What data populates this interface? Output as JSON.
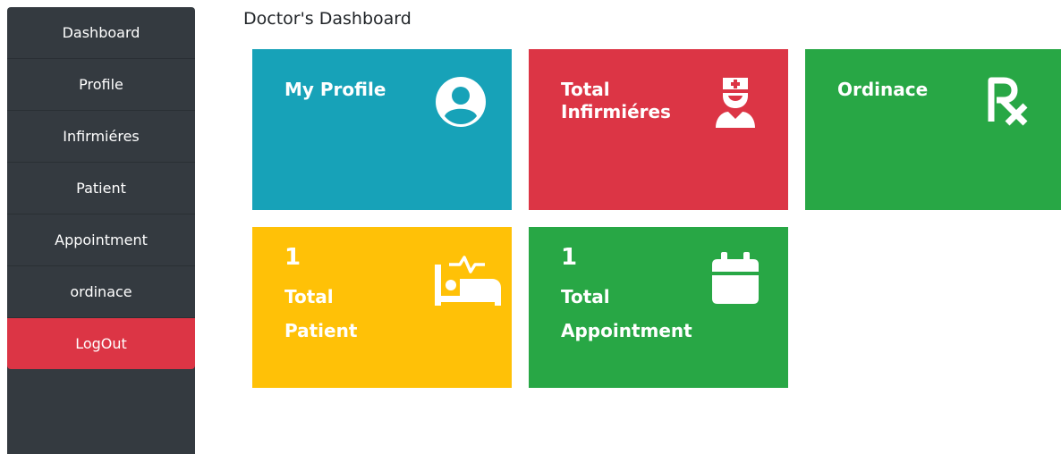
{
  "sidebar": {
    "items": [
      {
        "label": "Dashboard"
      },
      {
        "label": "Profile"
      },
      {
        "label": "Infirmiéres"
      },
      {
        "label": "Patient"
      },
      {
        "label": "Appointment"
      },
      {
        "label": "ordinace"
      },
      {
        "label": "LogOut",
        "active": true
      }
    ]
  },
  "page_title": "Doctor's Dashboard",
  "tiles": {
    "profile": {
      "title": "My Profile",
      "color": "#17a2b8",
      "icon": "user-circle-icon"
    },
    "nurses": {
      "title_line1": "Total",
      "title_line2": "Infirmiéres",
      "color": "#dc3545",
      "icon": "nurse-icon"
    },
    "ordinace": {
      "title": "Ordinace",
      "color": "#28a745",
      "icon": "prescription-icon"
    },
    "patients": {
      "count": "1",
      "label_line1": "Total",
      "label_line2": "Patient",
      "color": "#ffc107",
      "icon": "hospital-bed-icon"
    },
    "appointments": {
      "count": "1",
      "label_line1": "Total",
      "label_line2": "Appointment",
      "color": "#28a745",
      "icon": "calendar-icon"
    }
  },
  "colors": {
    "sidebar_bg": "#343a40",
    "logout_bg": "#dc3545"
  }
}
